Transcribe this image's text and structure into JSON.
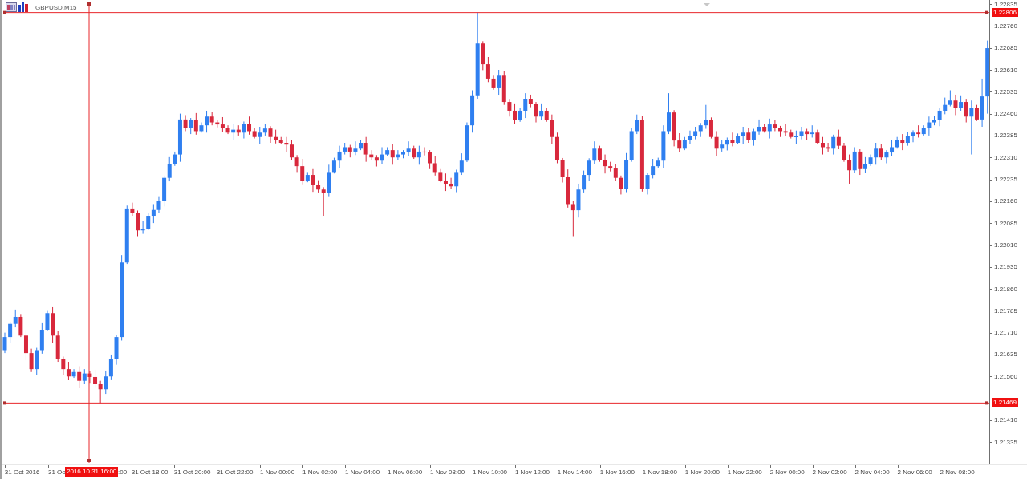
{
  "chart": {
    "symbol": "GBPUSD,M15",
    "chart_data": {
      "type": "candlestick",
      "ylim": [
        1.21264,
        1.22849
      ],
      "ref_lines": [
        {
          "axis": "y",
          "value": 1.22806
        },
        {
          "axis": "y",
          "value": 1.21469
        }
      ],
      "yticks": [
        {
          "value": 1.22835,
          "label": "1.22835"
        },
        {
          "value": 1.2276,
          "label": "1.22760"
        },
        {
          "value": 1.22685,
          "label": "1.22685"
        },
        {
          "value": 1.2261,
          "label": "1.22610"
        },
        {
          "value": 1.22535,
          "label": "1.22535"
        },
        {
          "value": 1.2246,
          "label": "1.22460"
        },
        {
          "value": 1.22385,
          "label": "1.22385"
        },
        {
          "value": 1.2231,
          "label": "1.22310"
        },
        {
          "value": 1.22235,
          "label": "1.22235"
        },
        {
          "value": 1.2216,
          "label": "1.22160"
        },
        {
          "value": 1.22085,
          "label": "1.22085"
        },
        {
          "value": 1.2201,
          "label": "1.22010"
        },
        {
          "value": 1.21935,
          "label": "1.21935"
        },
        {
          "value": 1.2186,
          "label": "1.21860"
        },
        {
          "value": 1.21785,
          "label": "1.21785"
        },
        {
          "value": 1.2171,
          "label": "1.21710"
        },
        {
          "value": 1.21635,
          "label": "1.21635"
        },
        {
          "value": 1.2156,
          "label": "1.21560"
        },
        {
          "value": 1.2141,
          "label": "1.21410"
        },
        {
          "value": 1.21335,
          "label": "1.21335"
        }
      ],
      "categories": [
        null,
        null,
        null,
        "31 Oct 2016",
        null,
        null,
        null,
        null,
        null,
        null,
        null,
        null,
        null,
        null,
        null,
        null,
        null,
        null,
        null,
        null,
        null,
        null,
        null,
        null,
        null,
        null,
        null,
        "31 Oct 18:00",
        null,
        null,
        null,
        null,
        null,
        null,
        null,
        "31 Oct 20:00",
        null,
        null,
        null,
        null,
        null,
        null,
        null,
        "31 Oct 22:00",
        null,
        null,
        null,
        null,
        null,
        null,
        null,
        "1 Nov 00:00",
        null,
        null,
        null,
        null,
        null,
        null,
        null,
        "1 Nov 02:00",
        null,
        null,
        null,
        null,
        null,
        null,
        null,
        "1 Nov 04:00",
        null,
        null,
        null,
        null,
        null,
        null,
        null,
        "1 Nov 06:00",
        null,
        null,
        null,
        null,
        null,
        null,
        null,
        "1 Nov 08:00",
        null,
        null,
        null,
        null,
        null,
        null,
        null,
        "1 Nov 10:00",
        null,
        null,
        null,
        null,
        null,
        null,
        null,
        "1 Nov 12:00",
        null,
        null,
        null,
        null,
        null,
        null,
        null,
        "1 Nov 14:00",
        null,
        null,
        null,
        null,
        null,
        null,
        null,
        "1 Nov 16:00",
        null,
        null,
        null,
        null,
        null,
        null,
        null,
        "1 Nov 18:00",
        null,
        null,
        null,
        null,
        null,
        null,
        null,
        "1 Nov 20:00",
        null,
        null,
        null,
        null,
        null,
        null,
        null,
        "1 Nov 22:00",
        null,
        null,
        null,
        null,
        null,
        null,
        null,
        "2 Nov 00:00",
        null,
        null,
        null,
        null,
        null,
        null,
        null,
        "2 Nov 02:00",
        null,
        null,
        null,
        null,
        null,
        null,
        null,
        "2 Nov 04:00",
        null,
        null,
        null,
        null,
        null,
        null,
        null,
        "2 Nov 06:00",
        null,
        null,
        null,
        null,
        null,
        null,
        null,
        "2 Nov 08:00",
        null,
        null,
        null,
        null,
        null,
        null
      ],
      "ohlc": [
        [
          1.2165,
          1.2171,
          1.2164,
          1.21695
        ],
        [
          1.21695,
          1.21748,
          1.21675,
          1.2174
        ],
        [
          1.2174,
          1.21789,
          1.21728,
          1.21764
        ],
        [
          1.21764,
          1.21774,
          1.21695,
          1.217
        ],
        [
          1.217,
          1.2172,
          1.21615,
          1.2164
        ],
        [
          1.2164,
          1.21655,
          1.21575,
          1.21585
        ],
        [
          1.21585,
          1.21658,
          1.21565,
          1.2165
        ],
        [
          1.2165,
          1.21745,
          1.21638,
          1.2172
        ],
        [
          1.2172,
          1.21787,
          1.21715,
          1.21777
        ],
        [
          1.21777,
          1.21797,
          1.21675,
          1.217
        ],
        [
          1.217,
          1.21715,
          1.2161,
          1.2162
        ],
        [
          1.2162,
          1.21628,
          1.21565,
          1.21585
        ],
        [
          1.21585,
          1.2161,
          1.21548,
          1.2156
        ],
        [
          1.2156,
          1.21585,
          1.21555,
          1.21575
        ],
        [
          1.21575,
          1.21595,
          1.2152,
          1.21545
        ],
        [
          1.21545,
          1.21585,
          1.21535,
          1.2157
        ],
        [
          1.2157,
          1.21578,
          1.21538,
          1.21558
        ],
        [
          1.21558,
          1.21583,
          1.21523,
          1.21535
        ],
        [
          1.21535,
          1.21545,
          1.21469,
          1.21516
        ],
        [
          1.21516,
          1.2158,
          1.215,
          1.2156
        ],
        [
          1.2156,
          1.21635,
          1.2155,
          1.2162
        ],
        [
          1.2162,
          1.21703,
          1.216,
          1.21695
        ],
        [
          1.21695,
          1.21975,
          1.21683,
          1.2195
        ],
        [
          1.2195,
          1.22145,
          1.21945,
          1.22135
        ],
        [
          1.22135,
          1.22155,
          1.2211,
          1.2212
        ],
        [
          1.2212,
          1.22128,
          1.2204,
          1.2206
        ],
        [
          1.2206,
          1.22091,
          1.22048,
          1.22066
        ],
        [
          1.22066,
          1.2212,
          1.22061,
          1.2211
        ],
        [
          1.2211,
          1.2215,
          1.22085,
          1.2213
        ],
        [
          1.2213,
          1.22177,
          1.2212,
          1.22162
        ],
        [
          1.22162,
          1.22248,
          1.22142,
          1.2224
        ],
        [
          1.2224,
          1.22311,
          1.22228,
          1.22286
        ],
        [
          1.22286,
          1.2233,
          1.22281,
          1.2232
        ],
        [
          1.2232,
          1.2246,
          1.22295,
          1.2244
        ],
        [
          1.2244,
          1.22455,
          1.224,
          1.2241
        ],
        [
          1.2241,
          1.22445,
          1.2239,
          1.22437
        ],
        [
          1.22437,
          1.22462,
          1.22388,
          1.224
        ],
        [
          1.224,
          1.2243,
          1.22395,
          1.2242
        ],
        [
          1.2242,
          1.2247,
          1.22395,
          1.2245
        ],
        [
          1.2245,
          1.22465,
          1.2242,
          1.2243
        ],
        [
          1.2243,
          1.22438,
          1.22413,
          1.22423
        ],
        [
          1.22423,
          1.22448,
          1.22398,
          1.2241
        ],
        [
          1.2241,
          1.2242,
          1.2239,
          1.22395
        ],
        [
          1.22395,
          1.22425,
          1.2237,
          1.22405
        ],
        [
          1.22405,
          1.2242,
          1.22385,
          1.22395
        ],
        [
          1.22395,
          1.22433,
          1.22375,
          1.22425
        ],
        [
          1.22425,
          1.2245,
          1.22388,
          1.224
        ],
        [
          1.224,
          1.2241,
          1.22375,
          1.2238
        ],
        [
          1.2238,
          1.22415,
          1.22355,
          1.22395
        ],
        [
          1.22395,
          1.22424,
          1.22385,
          1.22409
        ],
        [
          1.22409,
          1.22417,
          1.2236,
          1.2238
        ],
        [
          1.2238,
          1.22405,
          1.22358,
          1.2237
        ],
        [
          1.2237,
          1.2238,
          1.22355,
          1.2236
        ],
        [
          1.2236,
          1.2238,
          1.22329,
          1.22354
        ],
        [
          1.22354,
          1.22369,
          1.223,
          1.2231
        ],
        [
          1.2231,
          1.22318,
          1.2226,
          1.2228
        ],
        [
          1.2228,
          1.22305,
          1.22218,
          1.2223
        ],
        [
          1.2223,
          1.2226,
          1.22225,
          1.2225
        ],
        [
          1.2225,
          1.2227,
          1.22192,
          1.22217
        ],
        [
          1.22217,
          1.22232,
          1.2219,
          1.222
        ],
        [
          1.222,
          1.22208,
          1.2211,
          1.22189
        ],
        [
          1.22189,
          1.22285,
          1.22177,
          1.2226
        ],
        [
          1.2226,
          1.22309,
          1.22255,
          1.22299
        ],
        [
          1.22299,
          1.2235,
          1.22274,
          1.2233
        ],
        [
          1.2233,
          1.2236,
          1.2232,
          1.22345
        ],
        [
          1.22345,
          1.22353,
          1.2231,
          1.2233
        ],
        [
          1.2233,
          1.22365,
          1.22318,
          1.2234
        ],
        [
          1.2234,
          1.2237,
          1.22335,
          1.2236
        ],
        [
          1.2236,
          1.2238,
          1.22295,
          1.2232
        ],
        [
          1.2232,
          1.22335,
          1.223,
          1.2231
        ],
        [
          1.2231,
          1.22318,
          1.22279,
          1.22299
        ],
        [
          1.22299,
          1.22345,
          1.22287,
          1.2232
        ],
        [
          1.2232,
          1.22345,
          1.22315,
          1.22335
        ],
        [
          1.22335,
          1.22355,
          1.22285,
          1.2231
        ],
        [
          1.2231,
          1.22335,
          1.223,
          1.2232
        ],
        [
          1.2232,
          1.22335,
          1.22307,
          1.22327
        ],
        [
          1.22327,
          1.22365,
          1.22315,
          1.2234
        ],
        [
          1.2234,
          1.2235,
          1.22305,
          1.2231
        ],
        [
          1.2231,
          1.2235,
          1.22285,
          1.2233
        ],
        [
          1.2233,
          1.22345,
          1.22317,
          1.22327
        ],
        [
          1.22327,
          1.22335,
          1.2227,
          1.2229
        ],
        [
          1.2229,
          1.22315,
          1.22248,
          1.2226
        ],
        [
          1.2226,
          1.2227,
          1.22225,
          1.2223
        ],
        [
          1.2223,
          1.22255,
          1.22195,
          1.2222
        ],
        [
          1.2222,
          1.2224,
          1.22201,
          1.22211
        ],
        [
          1.22211,
          1.22268,
          1.22191,
          1.2226
        ],
        [
          1.2226,
          1.22324,
          1.2225,
          1.22299
        ],
        [
          1.22299,
          1.2243,
          1.22294,
          1.2242
        ],
        [
          1.2242,
          1.2254,
          1.22395,
          1.2252
        ],
        [
          1.2252,
          1.22806,
          1.2251,
          1.227
        ],
        [
          1.227,
          1.22708,
          1.22609,
          1.22629
        ],
        [
          1.22629,
          1.22654,
          1.22568,
          1.2258
        ],
        [
          1.2258,
          1.2259,
          1.22542,
          1.22547
        ],
        [
          1.22547,
          1.2261,
          1.22522,
          1.2259
        ],
        [
          1.2259,
          1.22605,
          1.2249,
          1.225
        ],
        [
          1.225,
          1.22508,
          1.2245,
          1.2247
        ],
        [
          1.2247,
          1.22495,
          1.22425,
          1.22437
        ],
        [
          1.22437,
          1.2248,
          1.22432,
          1.2247
        ],
        [
          1.2247,
          1.2253,
          1.22445,
          1.2251
        ],
        [
          1.2251,
          1.22525,
          1.22482,
          1.22492
        ],
        [
          1.22492,
          1.225,
          1.2243,
          1.2245
        ],
        [
          1.2245,
          1.22495,
          1.22438,
          1.2247
        ],
        [
          1.2247,
          1.2248,
          1.22432,
          1.22437
        ],
        [
          1.22437,
          1.22457,
          1.22355,
          1.2238
        ],
        [
          1.2238,
          1.22395,
          1.2229,
          1.223
        ],
        [
          1.223,
          1.22308,
          1.22224,
          1.22244
        ],
        [
          1.22244,
          1.22269,
          1.22138,
          1.2215
        ],
        [
          1.2215,
          1.2216,
          1.2204,
          1.22129
        ],
        [
          1.22129,
          1.2222,
          1.22104,
          1.222
        ],
        [
          1.222,
          1.22265,
          1.2219,
          1.2225
        ],
        [
          1.2225,
          1.22307,
          1.2223,
          1.22299
        ],
        [
          1.22299,
          1.22365,
          1.22288,
          1.2234
        ],
        [
          1.2234,
          1.2235,
          1.22295,
          1.223
        ],
        [
          1.223,
          1.2232,
          1.22255,
          1.2228
        ],
        [
          1.2228,
          1.22295,
          1.22262,
          1.22272
        ],
        [
          1.22272,
          1.22287,
          1.2223,
          1.2224
        ],
        [
          1.2224,
          1.22248,
          1.22183,
          1.22203
        ],
        [
          1.22203,
          1.22325,
          1.22191,
          1.223
        ],
        [
          1.223,
          1.2241,
          1.22295,
          1.224
        ],
        [
          1.224,
          1.22457,
          1.2239,
          1.22437
        ],
        [
          1.22437,
          1.22452,
          1.22193,
          1.22203
        ],
        [
          1.22203,
          1.22258,
          1.22183,
          1.2225
        ],
        [
          1.2225,
          1.22305,
          1.22238,
          1.2228
        ],
        [
          1.2228,
          1.22309,
          1.22275,
          1.22299
        ],
        [
          1.22299,
          1.2242,
          1.22274,
          1.224
        ],
        [
          1.224,
          1.2253,
          1.2239,
          1.22464
        ],
        [
          1.22464,
          1.22472,
          1.22348,
          1.22368
        ],
        [
          1.22368,
          1.22393,
          1.22328,
          1.2234
        ],
        [
          1.2234,
          1.2238,
          1.22335,
          1.2237
        ],
        [
          1.2237,
          1.22402,
          1.22357,
          1.22382
        ],
        [
          1.22382,
          1.22415,
          1.22372,
          1.224
        ],
        [
          1.224,
          1.22428,
          1.2238,
          1.2242
        ],
        [
          1.2242,
          1.2249,
          1.22408,
          1.22437
        ],
        [
          1.22437,
          1.22447,
          1.22375,
          1.2238
        ],
        [
          1.2238,
          1.224,
          1.22315,
          1.2234
        ],
        [
          1.2234,
          1.22369,
          1.2233,
          1.22354
        ],
        [
          1.22354,
          1.22378,
          1.22334,
          1.2237
        ],
        [
          1.2237,
          1.22395,
          1.22348,
          1.2236
        ],
        [
          1.2236,
          1.22392,
          1.22355,
          1.22382
        ],
        [
          1.22382,
          1.22415,
          1.22357,
          1.22395
        ],
        [
          1.22395,
          1.2241,
          1.2236,
          1.2237
        ],
        [
          1.2237,
          1.22408,
          1.2235,
          1.224
        ],
        [
          1.224,
          1.2244,
          1.22388,
          1.22415
        ],
        [
          1.22415,
          1.22425,
          1.22395,
          1.224
        ],
        [
          1.224,
          1.22443,
          1.22375,
          1.22423
        ],
        [
          1.22423,
          1.22438,
          1.224,
          1.2241
        ],
        [
          1.2241,
          1.22418,
          1.2238,
          1.224
        ],
        [
          1.224,
          1.22425,
          1.22383,
          1.22395
        ],
        [
          1.22395,
          1.22405,
          1.22375,
          1.2238
        ],
        [
          1.2238,
          1.22402,
          1.22355,
          1.22382
        ],
        [
          1.22382,
          1.22415,
          1.22372,
          1.224
        ],
        [
          1.224,
          1.22408,
          1.2237,
          1.2239
        ],
        [
          1.2239,
          1.2242,
          1.22378,
          1.22395
        ],
        [
          1.22395,
          1.22405,
          1.22355,
          1.2236
        ],
        [
          1.2236,
          1.2238,
          1.2232,
          1.22345
        ],
        [
          1.22345,
          1.2236,
          1.2233,
          1.2234
        ],
        [
          1.2234,
          1.22388,
          1.2232,
          1.2238
        ],
        [
          1.2238,
          1.22405,
          1.22338,
          1.2235
        ],
        [
          1.2235,
          1.2236,
          1.22295,
          1.223
        ],
        [
          1.223,
          1.2232,
          1.2222,
          1.22266
        ],
        [
          1.22266,
          1.22345,
          1.22256,
          1.2233
        ],
        [
          1.2233,
          1.22338,
          1.2225,
          1.2227
        ],
        [
          1.2227,
          1.22311,
          1.22258,
          1.22286
        ],
        [
          1.22286,
          1.2232,
          1.22281,
          1.2231
        ],
        [
          1.2231,
          1.2236,
          1.22285,
          1.2234
        ],
        [
          1.2234,
          1.22355,
          1.223,
          1.2231
        ],
        [
          1.2231,
          1.22335,
          1.2229,
          1.22327
        ],
        [
          1.22327,
          1.2237,
          1.22315,
          1.22345
        ],
        [
          1.22345,
          1.2238,
          1.2234,
          1.2237
        ],
        [
          1.2237,
          1.2239,
          1.22335,
          1.2236
        ],
        [
          1.2236,
          1.22397,
          1.2235,
          1.22382
        ],
        [
          1.22382,
          1.22403,
          1.22362,
          1.22395
        ],
        [
          1.22395,
          1.2242,
          1.22378,
          1.2239
        ],
        [
          1.2239,
          1.2242,
          1.22385,
          1.2241
        ],
        [
          1.2241,
          1.2245,
          1.22385,
          1.2243
        ],
        [
          1.2243,
          1.22452,
          1.2242,
          1.22437
        ],
        [
          1.22437,
          1.22478,
          1.22417,
          1.2247
        ],
        [
          1.2247,
          1.22515,
          1.22458,
          1.2249
        ],
        [
          1.2249,
          1.2254,
          1.22485,
          1.22505
        ],
        [
          1.22505,
          1.22525,
          1.22455,
          1.2248
        ],
        [
          1.2248,
          1.2252,
          1.2247,
          1.225
        ],
        [
          1.225,
          1.22508,
          1.2243,
          1.2245
        ],
        [
          1.2245,
          1.22505,
          1.2232,
          1.2248
        ],
        [
          1.2248,
          1.2249,
          1.22435,
          1.2244
        ],
        [
          1.2244,
          1.2258,
          1.22415,
          1.22519
        ],
        [
          1.22519,
          1.2271,
          1.2246,
          1.22684
        ]
      ]
    }
  },
  "time_axis": {
    "covered_labels": [
      "31 Oc",
      ":00"
    ]
  },
  "crosshair": {
    "price_high": "1.22806",
    "price_low": "1.21469",
    "time": "2016.10.31 16:00"
  }
}
